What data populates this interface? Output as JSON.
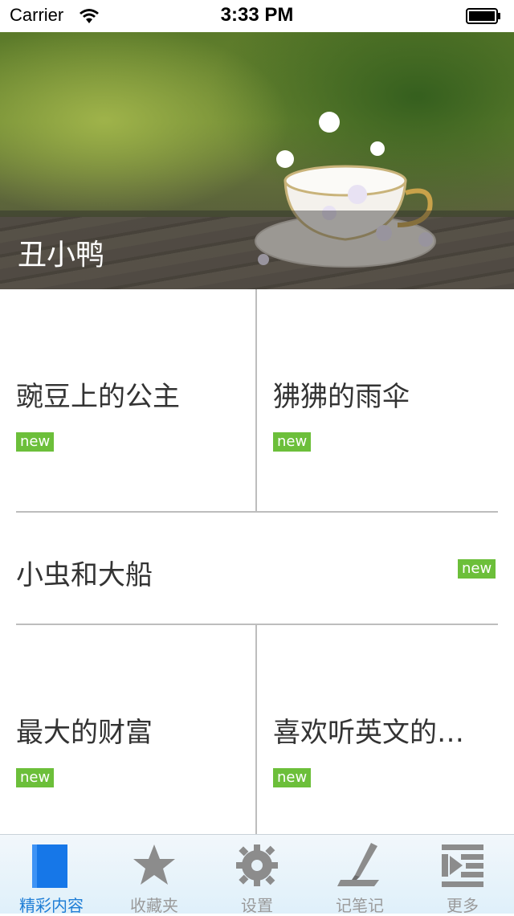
{
  "status_bar": {
    "carrier": "Carrier",
    "time": "3:33 PM"
  },
  "banner": {
    "title": "丑小鸭"
  },
  "stories": [
    {
      "title": "豌豆上的公主",
      "badge": "new"
    },
    {
      "title": "狒狒的雨伞",
      "badge": "new"
    },
    {
      "title": "小虫和大船",
      "badge": "new"
    },
    {
      "title": "最大的财富",
      "badge": "new"
    },
    {
      "title": "喜欢听英文的…",
      "badge": "new"
    }
  ],
  "tabs": [
    {
      "label": "精彩内容",
      "icon": "book-icon",
      "active": true
    },
    {
      "label": "收藏夹",
      "icon": "star-icon",
      "active": false
    },
    {
      "label": "设置",
      "icon": "gear-icon",
      "active": false
    },
    {
      "label": "记笔记",
      "icon": "pen-icon",
      "active": false
    },
    {
      "label": "更多",
      "icon": "list-icon",
      "active": false
    }
  ],
  "colors": {
    "accent": "#1f7ed6",
    "badge": "#6cbf3a",
    "tab_inactive": "#9a9a9a"
  }
}
